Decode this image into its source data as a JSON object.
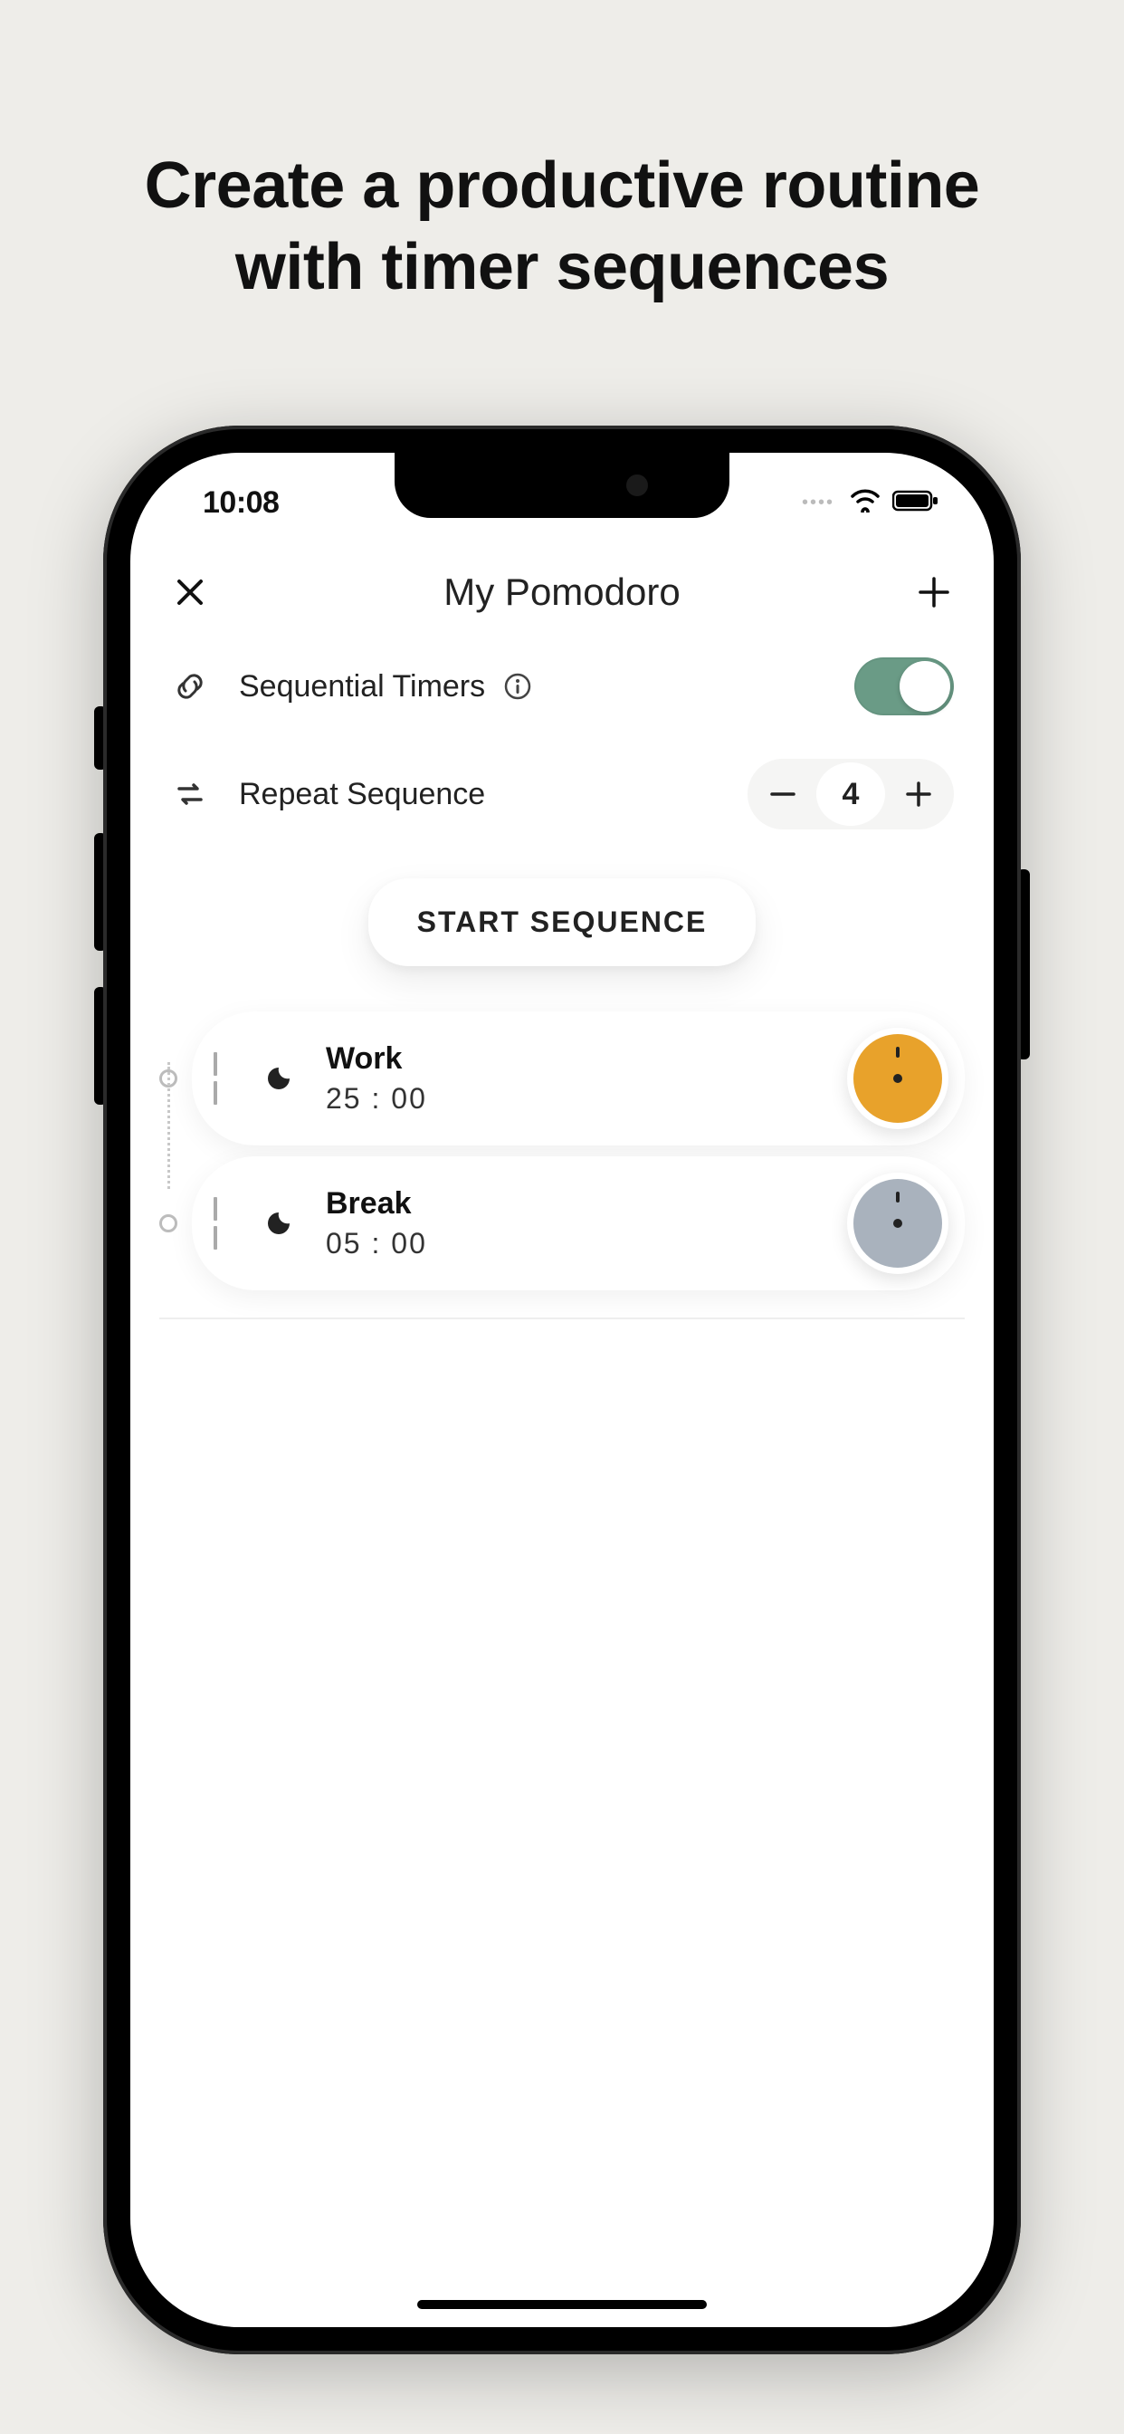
{
  "marketing": {
    "headline_line1": "Create a productive routine",
    "headline_line2": "with timer sequences"
  },
  "status": {
    "time": "10:08"
  },
  "nav": {
    "title": "My Pomodoro"
  },
  "settings": {
    "sequential_label": "Sequential Timers",
    "sequential_on": true,
    "repeat_label": "Repeat Sequence",
    "repeat_count": "4"
  },
  "actions": {
    "start_label": "START SEQUENCE"
  },
  "timers": [
    {
      "name": "Work",
      "duration": "25 : 00",
      "color": "#e8a22b"
    },
    {
      "name": "Break",
      "duration": "05 : 00",
      "color": "#a9b2bd"
    }
  ],
  "colors": {
    "toggle_on": "#6a9b86",
    "accent_orange": "#e8a22b",
    "accent_gray": "#a9b2bd"
  }
}
